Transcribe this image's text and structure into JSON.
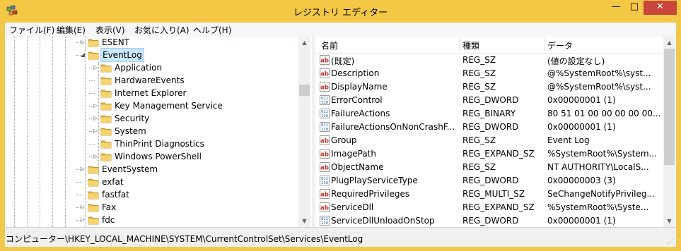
{
  "window": {
    "title": "レジストリ エディター",
    "controls": {
      "minimize": "—",
      "maximize": "□",
      "close": "✕"
    }
  },
  "menu": [
    {
      "label": "ファイル(F)"
    },
    {
      "label": "編集(E)"
    },
    {
      "label": "表示(V)"
    },
    {
      "label": "お気に入り(A)"
    },
    {
      "label": "ヘルプ(H)"
    }
  ],
  "tree": {
    "items": [
      {
        "label": "ESENT",
        "level": 0,
        "expander": "▷",
        "selected": false
      },
      {
        "label": "EventLog",
        "level": 0,
        "expander": "◢",
        "selected": true
      },
      {
        "label": "Application",
        "level": 1,
        "expander": "▷",
        "selected": false
      },
      {
        "label": "HardwareEvents",
        "level": 1,
        "expander": "",
        "selected": false
      },
      {
        "label": "Internet Explorer",
        "level": 1,
        "expander": "",
        "selected": false
      },
      {
        "label": "Key Management Service",
        "level": 1,
        "expander": "▷",
        "selected": false
      },
      {
        "label": "Security",
        "level": 1,
        "expander": "▷",
        "selected": false
      },
      {
        "label": "System",
        "level": 1,
        "expander": "▷",
        "selected": false
      },
      {
        "label": "ThinPrint Diagnostics",
        "level": 1,
        "expander": "",
        "selected": false
      },
      {
        "label": "Windows PowerShell",
        "level": 1,
        "expander": "▷",
        "selected": false
      },
      {
        "label": "EventSystem",
        "level": 0,
        "expander": "▷",
        "selected": false
      },
      {
        "label": "exfat",
        "level": 0,
        "expander": "",
        "selected": false
      },
      {
        "label": "fastfat",
        "level": 0,
        "expander": "",
        "selected": false
      },
      {
        "label": "Fax",
        "level": 0,
        "expander": "▷",
        "selected": false
      },
      {
        "label": "fdc",
        "level": 0,
        "expander": "▷",
        "selected": false
      }
    ]
  },
  "list": {
    "columns": {
      "name": "名前",
      "type": "種類",
      "data": "データ"
    },
    "rows": [
      {
        "icon": "string-value-icon",
        "name": "(既定)",
        "type": "REG_SZ",
        "data": "(値の設定なし)"
      },
      {
        "icon": "string-value-icon",
        "name": "Description",
        "type": "REG_SZ",
        "data": "@%SystemRoot%\\syst..."
      },
      {
        "icon": "string-value-icon",
        "name": "DisplayName",
        "type": "REG_SZ",
        "data": "@%SystemRoot%\\syst..."
      },
      {
        "icon": "binary-value-icon",
        "name": "ErrorControl",
        "type": "REG_DWORD",
        "data": "0x00000001 (1)"
      },
      {
        "icon": "binary-value-icon",
        "name": "FailureActions",
        "type": "REG_BINARY",
        "data": "80 51 01 00 00 00 00 00..."
      },
      {
        "icon": "binary-value-icon",
        "name": "FailureActionsOnNonCrashF...",
        "type": "REG_DWORD",
        "data": "0x00000001 (1)"
      },
      {
        "icon": "string-value-icon",
        "name": "Group",
        "type": "REG_SZ",
        "data": "Event Log"
      },
      {
        "icon": "string-value-icon",
        "name": "ImagePath",
        "type": "REG_EXPAND_SZ",
        "data": "%SystemRoot%\\System..."
      },
      {
        "icon": "string-value-icon",
        "name": "ObjectName",
        "type": "REG_SZ",
        "data": "NT AUTHORITY\\LocalS..."
      },
      {
        "icon": "binary-value-icon",
        "name": "PlugPlayServiceType",
        "type": "REG_DWORD",
        "data": "0x00000003 (3)"
      },
      {
        "icon": "string-value-icon",
        "name": "RequiredPrivileges",
        "type": "REG_MULTI_SZ",
        "data": "SeChangeNotifyPrivileg..."
      },
      {
        "icon": "string-value-icon",
        "name": "ServiceDll",
        "type": "REG_EXPAND_SZ",
        "data": "%SystemRoot%\\Syste..."
      },
      {
        "icon": "binary-value-icon",
        "name": "ServiceDllUnloadOnStop",
        "type": "REG_DWORD",
        "data": "0x00000001 (1)"
      }
    ]
  },
  "status": {
    "path": "コンピューター\\HKEY_LOCAL_MACHINE\\SYSTEM\\CurrentControlSet\\Services\\EventLog"
  },
  "colors": {
    "accent": "#f4c744",
    "close": "#c7453a",
    "selection": "#cce8ff",
    "string_icon": "#c0392b",
    "binary_icon": "#1f5fb4"
  }
}
